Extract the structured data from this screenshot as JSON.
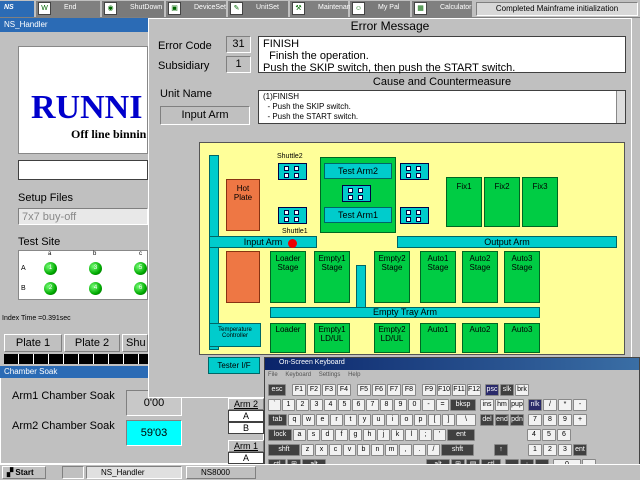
{
  "toolbar": {
    "logo": "NS",
    "buttons": [
      "End",
      "ShutDown",
      "DeviceSet",
      "UnitSet",
      "Maintenance",
      "My Pal",
      "Calculator"
    ],
    "status": "Completed Mainframe initialization"
  },
  "ns_handler": {
    "title": "NS_Handler",
    "running": "RUNNI",
    "sub": "Off line binnin",
    "setup_files_label": "Setup Files",
    "setup_file": "7x7 buy-off",
    "test_site_label": "Test Site",
    "site_cols": [
      "a",
      "b",
      "c"
    ],
    "site_rows": [
      {
        "row": "A",
        "leds": [
          "1",
          "3",
          "5"
        ]
      },
      {
        "row": "B",
        "leds": [
          "2",
          "4",
          "6"
        ]
      }
    ],
    "index_time": "Index Time =0.391sec",
    "plates": [
      "Plate 1",
      "Plate 2",
      "Shu"
    ]
  },
  "chamber": {
    "title": "Chamber Soak",
    "arm1_label": "Arm1 Chamber Soak",
    "arm1_value": "0'00",
    "arm2_label": "Arm2 Chamber Soak",
    "arm2_value": "59'03",
    "arm_tabs": [
      "Arm 2",
      "A",
      "B",
      "Arm 1",
      "A"
    ]
  },
  "error": {
    "title": "Error Message",
    "code_label": "Error Code",
    "code": "31",
    "subsidiary_label": "Subsidiary",
    "subsidiary": "1",
    "message": [
      "FINISH",
      "  Finish the operation.",
      "Push the SKIP switch, then push the START switch."
    ],
    "cause_title": "Cause and Countermeasure",
    "unit_name_label": "Unit Name",
    "unit_name": "Input Arm",
    "cause": [
      "(1)FINISH",
      "  - Push the SKIP switch.",
      "  - Push the START switch."
    ]
  },
  "layout": {
    "shuttle2": "Shuttle2",
    "shuttle1": "Shuttle1",
    "test_arm2": "Test Arm2",
    "test_arm1": "Test Arm1",
    "hot_plate": "Hot Plate",
    "fix": [
      "Fix1",
      "Fix2",
      "Fix3"
    ],
    "input_arm": "Input Arm",
    "output_arm": "Output Arm",
    "stages": [
      "Loader Stage",
      "Empty1 Stage",
      "Empty2 Stage",
      "Auto1 Stage",
      "Auto2 Stage",
      "Auto3 Stage"
    ],
    "empty_tray_arm": "Empty Tray Arm",
    "bottom": [
      "Loader",
      "Empty1 LD/UL",
      "Empty2 LD/UL",
      "Auto1",
      "Auto2",
      "Auto3"
    ],
    "temp_controller": "Temperature Controller",
    "tester": "Tester I/F"
  },
  "osk": {
    "title": "On-Screen Keyboard",
    "menu": [
      "File",
      "Keyboard",
      "Settings",
      "Help"
    ]
  },
  "taskbar": {
    "start": "Start",
    "tasks": [
      "NS_Handler",
      "NS8000"
    ]
  },
  "colors": {
    "title_blue": "#2b6bb5",
    "green": "#00cc44",
    "cyan": "#00cccc",
    "layout_bg": "#ffff99",
    "running": "#0000cc"
  }
}
